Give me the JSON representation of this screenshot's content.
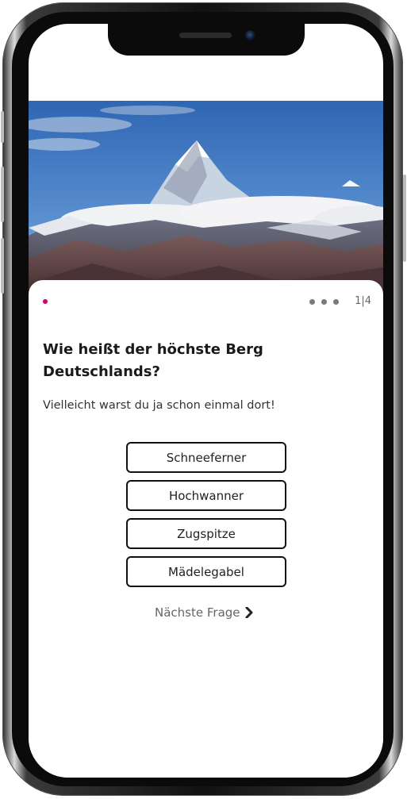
{
  "quiz": {
    "progress_text": "1|4",
    "question": "Wie heißt der höchste Berg Deutschlands?",
    "hint": "Vielleicht warst du ja schon einmal dort!",
    "answers": [
      {
        "label": "Schneeferner"
      },
      {
        "label": "Hochwanner"
      },
      {
        "label": "Zugspitze"
      },
      {
        "label": "Mädelegabel"
      }
    ],
    "next_label": "Nächste Frage"
  },
  "colors": {
    "accent": "#d0006f",
    "text": "#1a1a1a",
    "muted": "#666666",
    "sky": "#3f73b8"
  },
  "icons": {
    "next": "chevron-right-icon",
    "camera": "camera-icon",
    "hero": "mountain-image"
  }
}
